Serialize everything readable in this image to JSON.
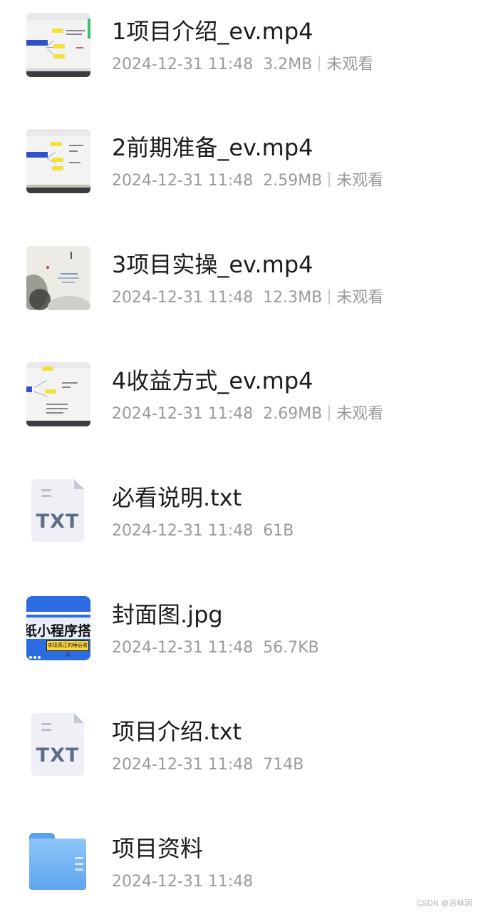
{
  "files": [
    {
      "name": "1项目介绍_ev.mp4",
      "date": "2024-12-31 11:48",
      "size": "3.2MB",
      "status": "未观看",
      "kind": "video",
      "icon": "video-thumbnail-icon"
    },
    {
      "name": "2前期准备_ev.mp4",
      "date": "2024-12-31 11:48",
      "size": "2.59MB",
      "status": "未观看",
      "kind": "video",
      "icon": "video-thumbnail-icon"
    },
    {
      "name": "3项目实操_ev.mp4",
      "date": "2024-12-31 11:48",
      "size": "12.3MB",
      "status": "未观看",
      "kind": "video",
      "icon": "video-thumbnail-icon"
    },
    {
      "name": "4收益方式_ev.mp4",
      "date": "2024-12-31 11:48",
      "size": "2.69MB",
      "status": "未观看",
      "kind": "video",
      "icon": "video-thumbnail-icon"
    },
    {
      "name": "必看说明.txt",
      "date": "2024-12-31 11:48",
      "size": "61B",
      "kind": "txt",
      "icon_label": "TXT",
      "icon": "txt-file-icon"
    },
    {
      "name": "封面图.jpg",
      "date": "2024-12-31 11:48",
      "size": "56.7KB",
      "kind": "image",
      "icon": "image-thumbnail-icon",
      "thumb_text": "纸小程序搭建教",
      "thumb_button": "实现真正的睡后收入"
    },
    {
      "name": "项目介绍.txt",
      "date": "2024-12-31 11:48",
      "size": "714B",
      "kind": "txt",
      "icon_label": "TXT",
      "icon": "txt-file-icon"
    },
    {
      "name": "项目资料",
      "date": "2024-12-31 11:48",
      "kind": "folder",
      "icon": "folder-icon"
    }
  ],
  "watermark": "CSDN @浴林涧",
  "colors": {
    "name": "#1c1c1e",
    "meta": "#9a9a9e",
    "folder": "#6aaef2",
    "txt_label": "#5f6e88"
  }
}
